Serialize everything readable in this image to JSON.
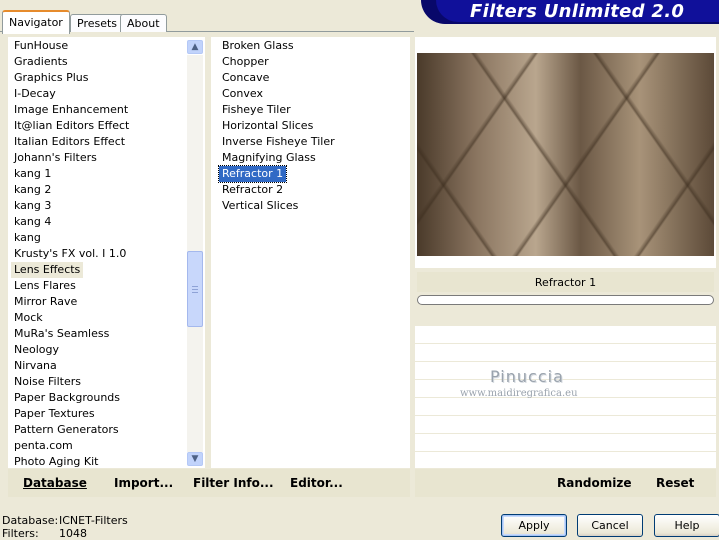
{
  "tabs": [
    "Navigator",
    "Presets",
    "About"
  ],
  "banner_title": "Filters Unlimited 2.0",
  "categories": [
    "FunHouse",
    "Gradients",
    "Graphics Plus",
    "I-Decay",
    "Image Enhancement",
    "It@lian Editors Effect",
    "Italian Editors Effect",
    "Johann's Filters",
    "kang 1",
    "kang 2",
    "kang 3",
    "kang 4",
    "kang",
    "Krusty's FX vol. I 1.0",
    "Lens Effects",
    "Lens Flares",
    "Mirror Rave",
    "Mock",
    "MuRa's Seamless",
    "Neology",
    "Nirvana",
    "Noise Filters",
    "Paper Backgrounds",
    "Paper Textures",
    "Pattern Generators",
    "penta.com",
    "Photo Aging Kit"
  ],
  "selected_category": "Lens Effects",
  "filters": [
    "Broken Glass",
    "Chopper",
    "Concave",
    "Convex",
    "Fisheye Tiler",
    "Horizontal Slices",
    "Inverse Fisheye Tiler",
    "Magnifying Glass",
    "Refractor 1",
    "Refractor 2",
    "Vertical Slices"
  ],
  "selected_filter": "Refractor 1",
  "preview_caption": "Refractor 1",
  "watermark": {
    "name": "Pinuccia",
    "url": "www.maidiregrafica.eu"
  },
  "left_buttons": {
    "database": "Database",
    "import": "Import...",
    "filter_info": "Filter Info...",
    "editor": "Editor..."
  },
  "right_buttons": {
    "randomize": "Randomize",
    "reset": "Reset"
  },
  "footer": {
    "database_label": "Database:",
    "database_value": "ICNET-Filters",
    "filters_label": "Filters:",
    "filters_value": "1048"
  },
  "dialog_buttons": {
    "apply": "Apply",
    "cancel": "Cancel",
    "help": "Help"
  },
  "colors": {
    "banner": "#10109a",
    "selection": "#316ac5",
    "background": "#ece9d8"
  }
}
